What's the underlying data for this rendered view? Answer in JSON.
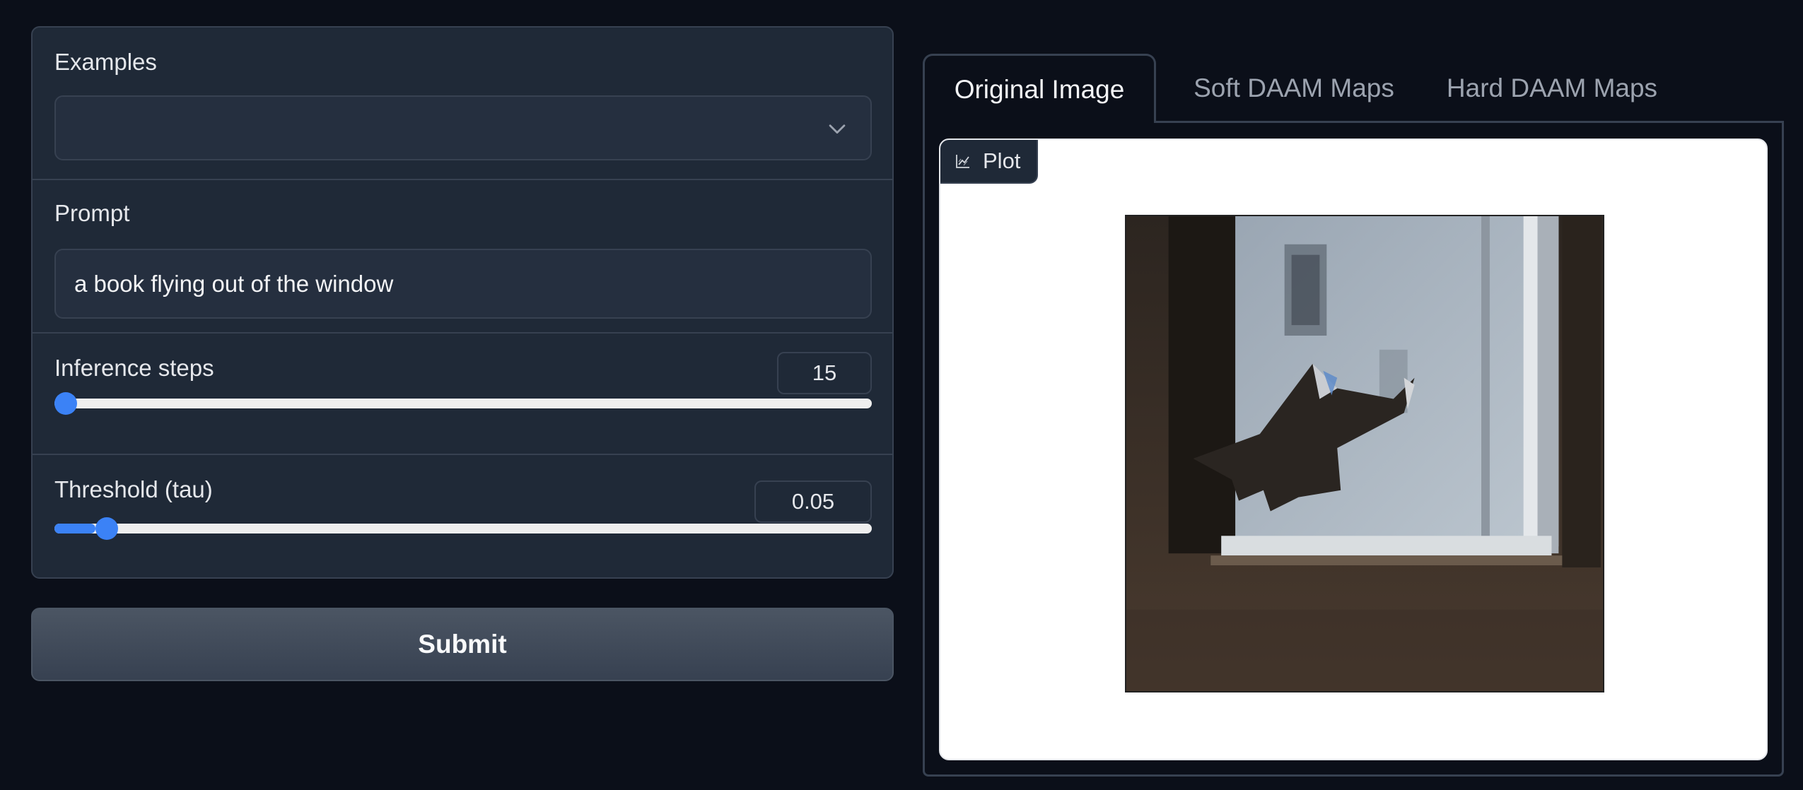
{
  "form": {
    "examples_label": "Examples",
    "examples_value": "",
    "prompt_label": "Prompt",
    "prompt_value": "a book flying out of the window",
    "steps_label": "Inference steps",
    "steps_value": "15",
    "steps_fraction": 0.0,
    "tau_label": "Threshold (tau)",
    "tau_value": "0.05",
    "tau_fraction": 0.05
  },
  "submit_label": "Submit",
  "tabs": [
    {
      "label": "Original Image",
      "active": true
    },
    {
      "label": "Soft DAAM Maps",
      "active": false
    },
    {
      "label": "Hard DAAM Maps",
      "active": false
    }
  ],
  "plot": {
    "badge_label": "Plot",
    "badge_icon": "chart-icon",
    "image_description_icon": "generated-image"
  },
  "colors": {
    "accent": "#3b82f6",
    "background": "#0b0f19",
    "panel": "#1f2937",
    "border": "#374151"
  }
}
